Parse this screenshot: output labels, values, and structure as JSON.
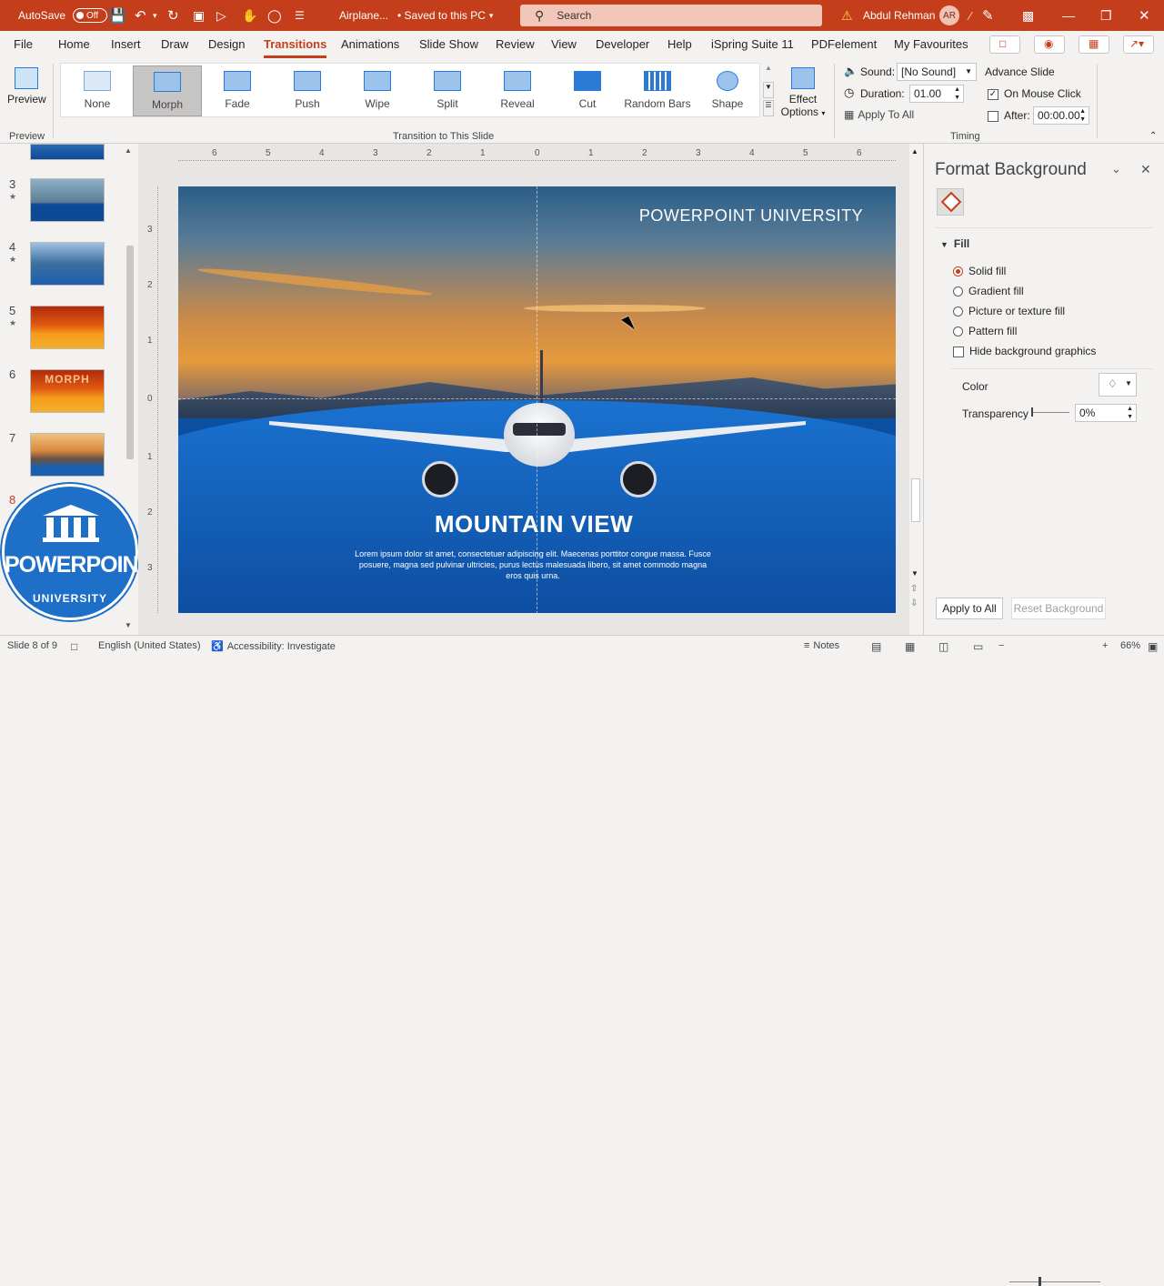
{
  "titlebar": {
    "autosave_label": "AutoSave",
    "autosave_state": "Off",
    "doc_name": "Airplane...",
    "save_status": "• Saved to this PC",
    "search_placeholder": "Search",
    "user_name": "Abdul Rehman",
    "user_initials": "AR",
    "accent": "#c43e1c"
  },
  "menu": {
    "items": [
      "File",
      "Home",
      "Insert",
      "Draw",
      "Design",
      "Transitions",
      "Animations",
      "Slide Show",
      "Review",
      "View",
      "Developer",
      "Help",
      "iSpring Suite 11",
      "PDFelement",
      "My Favourites"
    ],
    "active": "Transitions"
  },
  "ribbon": {
    "preview_label": "Preview",
    "preview_group": "Preview",
    "transitions": [
      "None",
      "Morph",
      "Fade",
      "Push",
      "Wipe",
      "Split",
      "Reveal",
      "Cut",
      "Random Bars",
      "Shape"
    ],
    "selected_transition": "Morph",
    "effect_options_line1": "Effect",
    "effect_options_line2": "Options",
    "transition_group": "Transition to This Slide",
    "sound_label": "Sound:",
    "sound_value": "[No Sound]",
    "duration_label": "Duration:",
    "duration_value": "01.00",
    "apply_all_label": "Apply To All",
    "advance_label": "Advance Slide",
    "on_mouse_click_label": "On Mouse Click",
    "on_mouse_click_checked": true,
    "after_label": "After:",
    "after_value": "00:00.00",
    "timing_group": "Timing"
  },
  "thumbnails": [
    {
      "num": "3",
      "star": "★"
    },
    {
      "num": "4",
      "star": "★"
    },
    {
      "num": "5",
      "star": "★"
    },
    {
      "num": "6",
      "star": ""
    },
    {
      "num": "7",
      "star": ""
    },
    {
      "num": "8",
      "star": ""
    }
  ],
  "thumb_texts": {
    "morph": "MORPH"
  },
  "logo": {
    "line1": "POWERPOINT",
    "line2": "UNIVERSITY"
  },
  "ruler_h": [
    "6",
    "5",
    "4",
    "3",
    "2",
    "1",
    "0",
    "1",
    "2",
    "3",
    "4",
    "5",
    "6"
  ],
  "ruler_v": [
    "3",
    "2",
    "1",
    "0",
    "1",
    "2",
    "3"
  ],
  "slide": {
    "brand": "POWERPOINT UNIVERSITY",
    "title": "MOUNTAIN VIEW",
    "body": "Lorem ipsum dolor sit amet, consectetuer adipiscing elit. Maecenas porttitor congue massa. Fusce posuere, magna sed pulvinar ultricies, purus lectus malesuada libero, sit amet commodo magna eros quis urna."
  },
  "panel": {
    "title": "Format Background",
    "section": "Fill",
    "options": [
      "Solid fill",
      "Gradient fill",
      "Picture or texture fill",
      "Pattern fill"
    ],
    "selected": "Solid fill",
    "hide_bg_label": "Hide background graphics",
    "color_label": "Color",
    "transparency_label": "Transparency",
    "transparency_value": "0%",
    "apply_all": "Apply to All",
    "reset": "Reset Background"
  },
  "status": {
    "slide_info": "Slide 8 of 9",
    "language": "English (United States)",
    "accessibility": "Accessibility: Investigate",
    "notes": "Notes",
    "zoom": "66%"
  }
}
